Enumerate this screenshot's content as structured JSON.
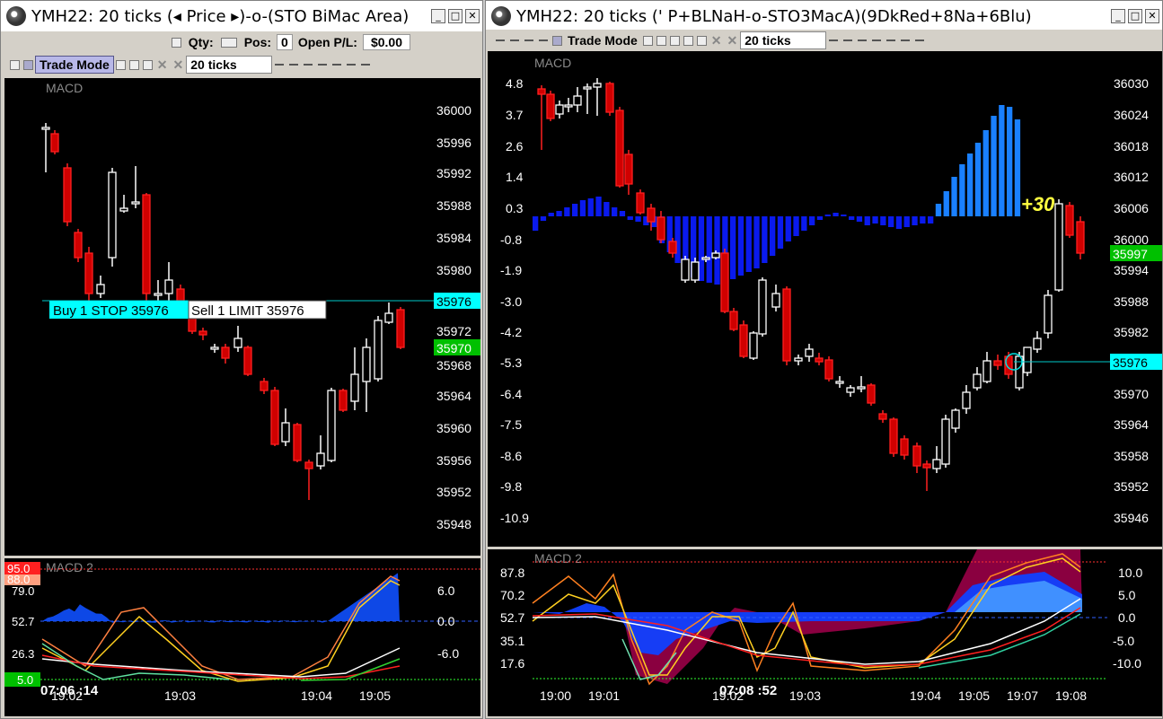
{
  "left": {
    "title": "YMH22: 20 ticks (◂ Price ▸)-o-(STO BiMac Area)",
    "qty_label": "Qty:",
    "pos_label": "Pos:",
    "pos_value": "0",
    "pl_label": "Open P/L:",
    "pl_value": "$0.00",
    "trade_mode": "Trade Mode",
    "ticks": "20 ticks",
    "price_panel_label": "MACD",
    "macd_panel_label": "MACD 2",
    "price_axis": [
      "36000",
      "35996",
      "35992",
      "35988",
      "35984",
      "35980",
      "35972",
      "35968",
      "35964",
      "35960",
      "35956",
      "35952",
      "35948"
    ],
    "last_price_badge": "35970",
    "order_price_badge": "35976",
    "buy_order": "Buy 1 STOP 35976",
    "sell_order": "Sell 1 LIMIT 35976",
    "macd_left_axis": [
      "95.0",
      "88.0",
      "79.0",
      "52.7",
      "26.3",
      "5.0"
    ],
    "macd_right_axis": [
      "6.0",
      "0.0",
      "-6.0"
    ],
    "time_axis": [
      "19:02",
      "19:03",
      "19:04",
      "19:05"
    ],
    "crosshair_time": "07:06 :14",
    "colors": {
      "up": "#ffffff",
      "down": "#ff0000",
      "cyan": "#00ffff",
      "green_badge": "#00c000"
    }
  },
  "right": {
    "title": "YMH22: 20 ticks (' P+BLNaH-o-STO3MacA)(9DkRed+8Na+6Blu)",
    "trade_mode": "Trade Mode",
    "ticks": "20 ticks",
    "price_panel_label": "MACD",
    "macd_panel_label": "MACD 2",
    "left_axis": [
      "4.8",
      "3.7",
      "2.6",
      "1.4",
      "0.3",
      "-0.8",
      "-1.9",
      "-3.0",
      "-4.2",
      "-5.3",
      "-6.4",
      "-7.5",
      "-8.6",
      "-9.8",
      "-10.9"
    ],
    "price_axis": [
      "36030",
      "36024",
      "36018",
      "36012",
      "36006",
      "36000",
      "35994",
      "35988",
      "35982",
      "35970",
      "35964",
      "35958",
      "35952",
      "35946"
    ],
    "last_price_badge": "35997",
    "order_price_badge": "35976",
    "profit_label": "+30",
    "macd_left_axis": [
      "87.8",
      "70.2",
      "52.7",
      "35.1",
      "17.6"
    ],
    "macd_right_axis": [
      "10.0",
      "5.0",
      "0.0",
      "-5.0",
      "-10.0"
    ],
    "time_axis": [
      "19:00",
      "19:01",
      "19:02",
      "19:03",
      "19:04",
      "19:05",
      "19:07",
      "19:08"
    ],
    "crosshair_time": "07:08 :52"
  }
}
